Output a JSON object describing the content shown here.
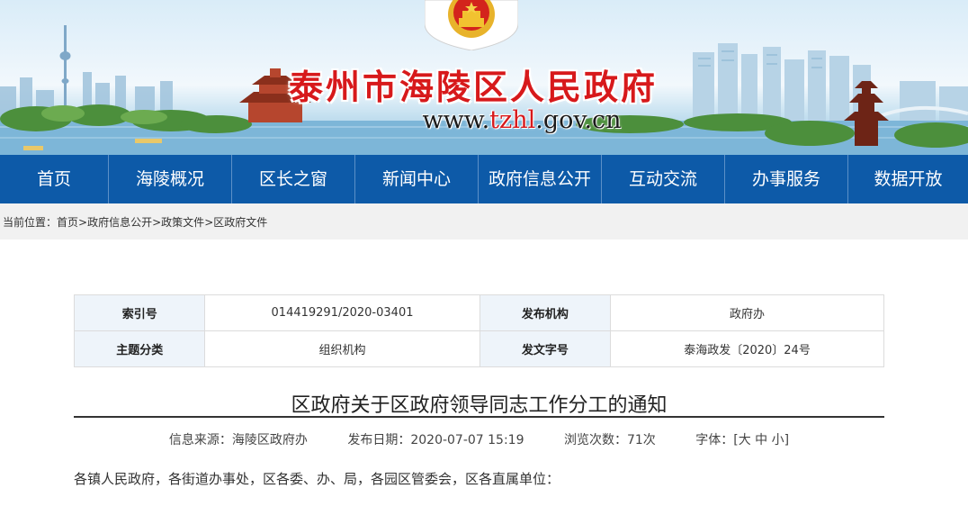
{
  "header": {
    "site_title": "泰州市海陵区人民政府",
    "url_prefix": "www.",
    "url_highlight": "tzhl",
    "url_suffix": ".gov.cn",
    "emblem_icon": "national-emblem-icon"
  },
  "nav": {
    "items": [
      "首页",
      "海陵概况",
      "区长之窗",
      "新闻中心",
      "政府信息公开",
      "互动交流",
      "办事服务",
      "数据开放"
    ],
    "background": "#0d5aa8"
  },
  "breadcrumb": {
    "prefix": "当前位置：",
    "items": [
      "首页",
      "政府信息公开",
      "政策文件",
      "区政府文件"
    ],
    "separator": ">"
  },
  "meta": {
    "index_label": "索引号",
    "index_value": "014419291/2020-03401",
    "publisher_label": "发布机构",
    "publisher_value": "政府办",
    "topic_label": "主题分类",
    "topic_value": "组织机构",
    "docno_label": "发文字号",
    "docno_value": "泰海政发〔2020〕24号"
  },
  "article": {
    "title": "区政府关于区政府领导同志工作分工的通知",
    "source": "信息来源：海陵区政府办",
    "date": "发布日期：2020-07-07 15:19",
    "views": "浏览次数：71次",
    "font_size_label": "字体：[",
    "font_large": "大",
    "font_medium": "中",
    "font_small": "小",
    "font_size_end": "]",
    "opening": "各镇人民政府，各街道办事处，区各委、办、局，各园区管委会，区各直属单位："
  },
  "colors": {
    "title_red": "#d7191b",
    "nav_blue": "#0d5aa8",
    "table_key_bg": "#eef4fa"
  }
}
